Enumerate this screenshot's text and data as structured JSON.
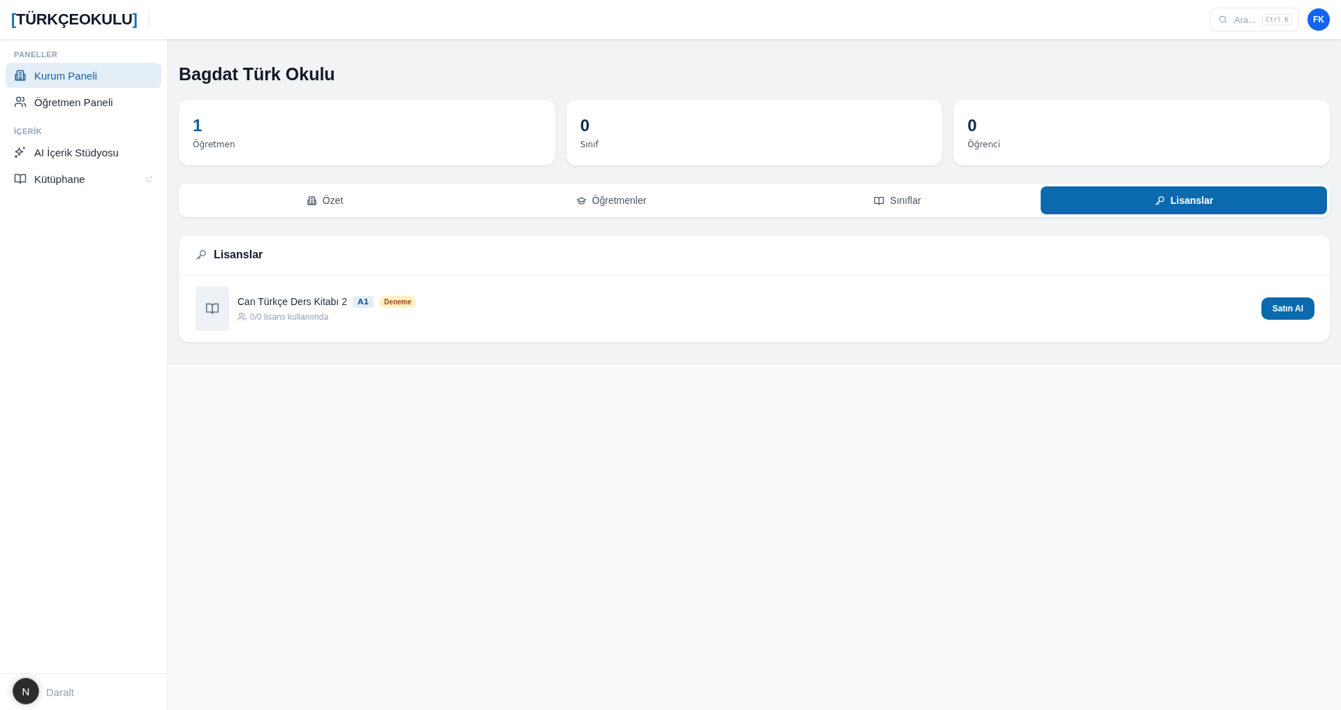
{
  "header": {
    "logo": {
      "bracket_left": "[",
      "name": "TÜRKÇEOKULU",
      "bracket_right": "]"
    },
    "search": {
      "placeholder": "Ara...",
      "shortcut": "Ctrl K"
    },
    "avatar": "FK"
  },
  "sidebar": {
    "sections": [
      {
        "title": "PANELLER",
        "items": [
          {
            "label": "Kurum Paneli",
            "selected": true,
            "external": false
          },
          {
            "label": "Öğretmen Paneli",
            "selected": false,
            "external": false
          }
        ]
      },
      {
        "title": "İÇERİK",
        "items": [
          {
            "label": "AI İçerik Stüdyosu",
            "selected": false,
            "external": false
          },
          {
            "label": "Kütüphane",
            "selected": false,
            "external": true
          }
        ]
      }
    ],
    "collapse": "Daralt",
    "dev_badge": "N"
  },
  "page": {
    "title": "Bagdat Türk Okulu",
    "stats": [
      {
        "value": "1",
        "label": "Öğretmen",
        "color": "#17609f"
      },
      {
        "value": "0",
        "label": "Sınıf",
        "color": "#10254a"
      },
      {
        "value": "0",
        "label": "Öğrenci",
        "color": "#10254a"
      }
    ],
    "tabs": [
      {
        "label": "Özet",
        "selected": false
      },
      {
        "label": "Öğretmenler",
        "selected": false
      },
      {
        "label": "Sınıflar",
        "selected": false
      },
      {
        "label": "Lisanslar",
        "selected": true
      }
    ],
    "licenses": {
      "title": "Lisanslar",
      "items": [
        {
          "title": "Can Türkçe Ders Kitabı 2",
          "level": "A1",
          "status": "Deneme",
          "usage": "0/0 lisans kullanımda",
          "button": "Satın Al"
        }
      ]
    }
  }
}
